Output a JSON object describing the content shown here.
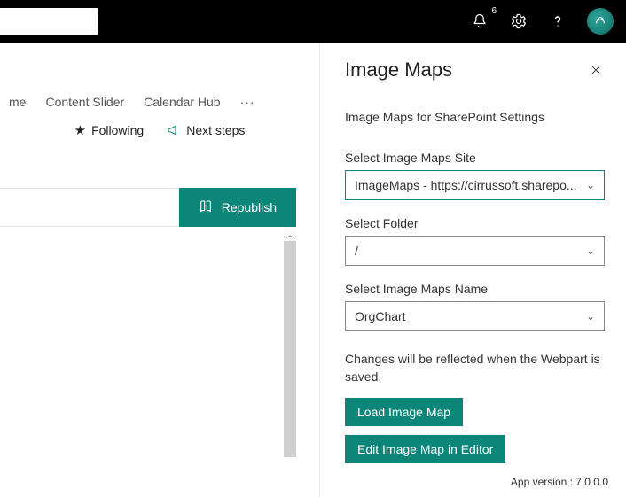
{
  "header": {
    "notification_count": "6"
  },
  "nav": {
    "tabs": [
      "me",
      "Content Slider",
      "Calendar Hub"
    ],
    "ellipsis": "···"
  },
  "actions": {
    "following": "Following",
    "next_steps": "Next steps"
  },
  "publish": {
    "republish": "Republish"
  },
  "panel": {
    "title": "Image Maps",
    "subtitle": "Image Maps for SharePoint Settings",
    "site_label": "Select Image Maps Site",
    "site_value": "ImageMaps - https://cirrussoft.sharepo...",
    "folder_label": "Select Folder",
    "folder_value": "/",
    "name_label": "Select Image Maps Name",
    "name_value": "OrgChart",
    "note": "Changes will be reflected when the Webpart is saved.",
    "load_btn": "Load Image Map",
    "edit_btn": "Edit Image Map in Editor",
    "version": "App version : 7.0.0.0"
  }
}
